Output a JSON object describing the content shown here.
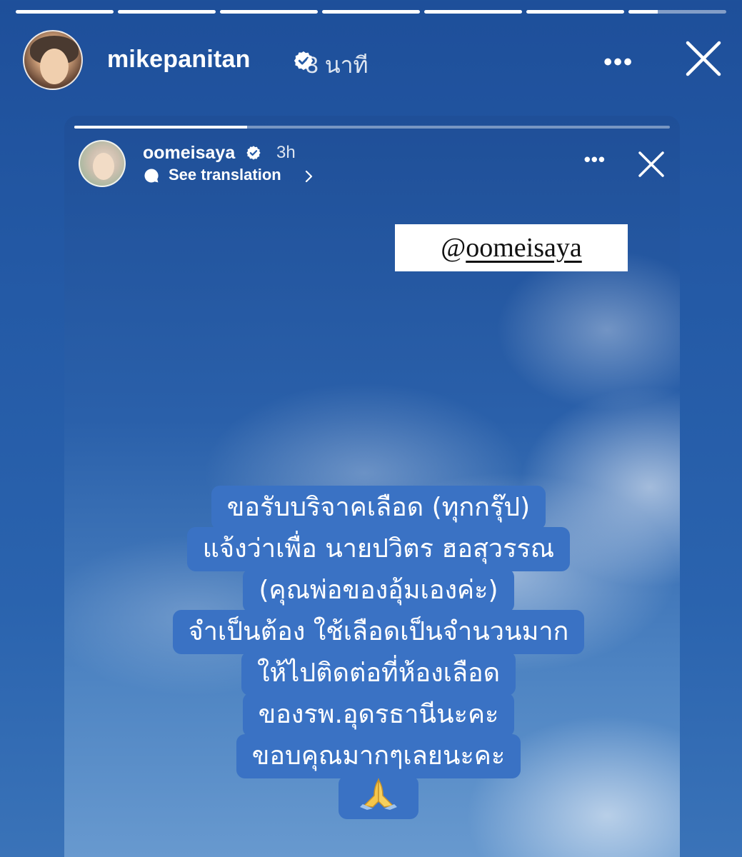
{
  "outer_story": {
    "progress": [
      1,
      1,
      1,
      1,
      1,
      1,
      0.3
    ],
    "username": "mikepanitan",
    "time": "3 นาที",
    "more_label": "•••"
  },
  "inner_story": {
    "progress": 0.29,
    "username": "oomeisaya",
    "time": "3h",
    "translate_label": "See translation",
    "more_label": "•••",
    "mention": {
      "at": "@",
      "handle": "oomeisaya"
    },
    "message_lines": [
      "ขอรับบริจาคเลือด (ทุกกรุ๊ป)",
      "แจ้งว่าเพื่อ นายปวิตร ฮอสุวรรณ",
      "(คุณพ่อของอุ้มเองค่ะ)",
      "จำเป็นต้อง ใช้เลือดเป็นจำนวนมาก",
      "ให้ไปติดต่อที่ห้องเลือด",
      "ของรพ.อุดรธานีนะคะ",
      "ขอบคุณมากๆเลยนะคะ"
    ],
    "emoji": "🙏"
  },
  "colors": {
    "sky": "#245aa6",
    "text_highlight": "#3a72c4",
    "verified_badge": "#ffffff"
  }
}
